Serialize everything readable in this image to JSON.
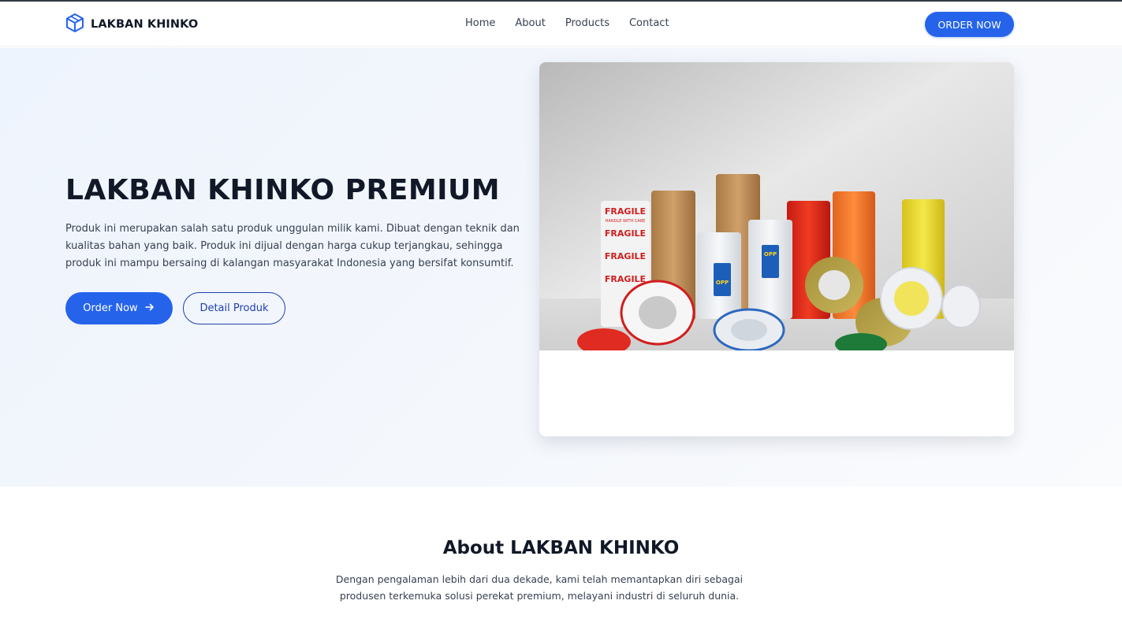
{
  "navbar": {
    "brand": "LAKBAN KHINKO",
    "brand_icon": "box-icon",
    "links": [
      "Home",
      "About",
      "Products",
      "Contact"
    ],
    "cta_label": "ORDER NOW"
  },
  "hero": {
    "title": "LAKBAN KHINKO PREMIUM",
    "description": "Produk ini merupakan salah satu produk unggulan milik kami. Dibuat dengan teknik dan kualitas bahan yang baik. Produk ini dijual dengan harga cukup terjangkau, sehingga produk ini mampu bersaing di kalangan masyarakat Indonesia yang bersifat konsumtif.",
    "primary_button": "Order Now",
    "primary_button_icon": "arrow-right-icon",
    "secondary_button": "Detail Produk",
    "image_tape_labels": [
      "FRAGILE",
      "HANDLE WITH CARE",
      "OPP"
    ]
  },
  "about": {
    "title": "About LAKBAN KHINKO",
    "description": "Dengan pengalaman lebih dari dua dekade, kami telah memantapkan diri sebagai produsen terkemuka solusi perekat premium, melayani industri di seluruh dunia."
  },
  "colors": {
    "accent": "#2563eb",
    "outline": "#1e40af",
    "text": "#111827",
    "hero_bg": "#eef4fd"
  }
}
